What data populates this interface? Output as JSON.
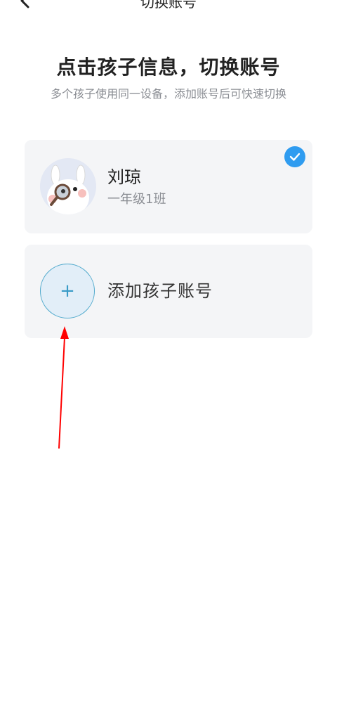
{
  "nav": {
    "title": "切换账号",
    "back_icon": "back-arrow-icon"
  },
  "header": {
    "title": "点击孩子信息，切换账号",
    "subtitle": "多个孩子使用同一设备，添加账号后可快速切换"
  },
  "accounts": [
    {
      "name": "刘琼",
      "class": "一年级1班",
      "selected": true,
      "avatar_icon": "bunny-avatar-icon",
      "check_icon": "check-icon"
    }
  ],
  "add_account": {
    "label": "添加孩子账号",
    "plus": "+",
    "icon": "plus-icon"
  },
  "colors": {
    "accent": "#2f9cf0",
    "annotation_arrow": "#ff0000"
  }
}
